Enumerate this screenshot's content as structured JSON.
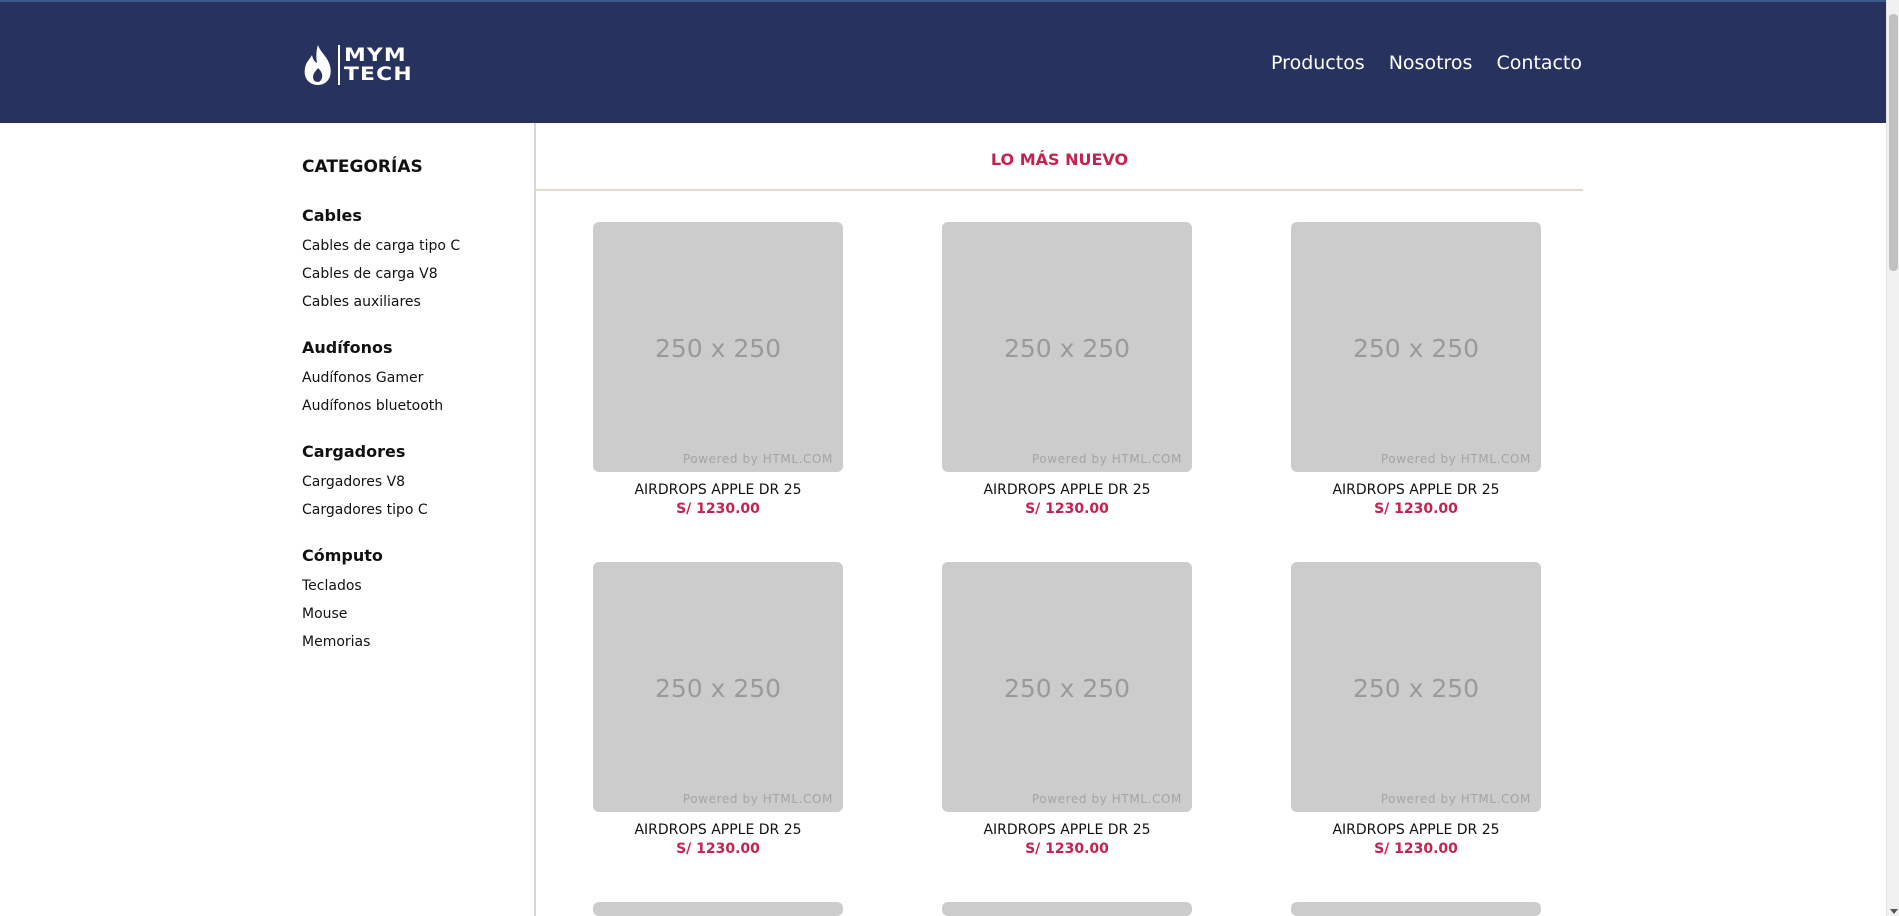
{
  "header": {
    "logo_line1": "MYM",
    "logo_line2": "TECH",
    "nav": [
      "Productos",
      "Nosotros",
      "Contacto"
    ]
  },
  "sidebar": {
    "title": "CATEGORÍAS",
    "groups": [
      {
        "title": "Cables",
        "items": [
          "Cables de carga tipo C",
          "Cables de carga V8",
          "Cables auxiliares"
        ]
      },
      {
        "title": "Audífonos",
        "items": [
          "Audífonos Gamer",
          "Audífonos bluetooth"
        ]
      },
      {
        "title": "Cargadores",
        "items": [
          "Cargadores V8",
          "Cargadores tipo C"
        ]
      },
      {
        "title": "Cómputo",
        "items": [
          "Teclados",
          "Mouse",
          "Memorias"
        ]
      }
    ]
  },
  "main": {
    "section_title": "LO MÁS NUEVO",
    "placeholder_size": "250 x 250",
    "placeholder_powered": "Powered by HTML.COM",
    "products": [
      {
        "name": "AIRDROPS APPLE DR 25",
        "price": "S/ 1230.00"
      },
      {
        "name": "AIRDROPS APPLE DR 25",
        "price": "S/ 1230.00"
      },
      {
        "name": "AIRDROPS APPLE DR 25",
        "price": "S/ 1230.00"
      },
      {
        "name": "AIRDROPS APPLE DR 25",
        "price": "S/ 1230.00"
      },
      {
        "name": "AIRDROPS APPLE DR 25",
        "price": "S/ 1230.00"
      },
      {
        "name": "AIRDROPS APPLE DR 25",
        "price": "S/ 1230.00"
      }
    ]
  },
  "colors": {
    "header_bg": "#27325e",
    "accent": "#c4234f",
    "placeholder_bg": "#cccccc"
  }
}
